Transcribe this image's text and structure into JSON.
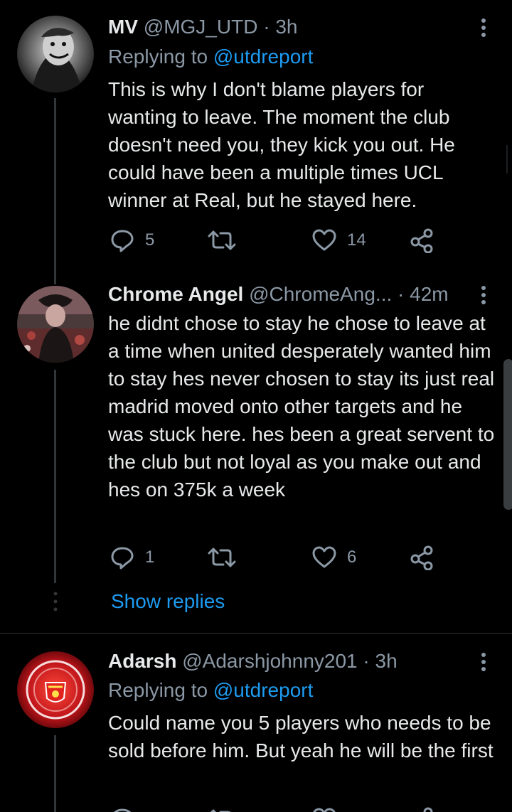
{
  "tweets": [
    {
      "name": "MV",
      "handle": "@MGJ_UTD",
      "sep": "·",
      "time": "3h",
      "replying_prefix": "Replying to",
      "replying_to": "@utdreport",
      "text": "This is why I don't blame players for wanting to leave. The moment the club doesn't need you, they kick you out. He could have been a multiple times UCL winner at Real, but he stayed here.",
      "reply_count": "5",
      "retweet_count": "",
      "like_count": "14"
    },
    {
      "name": "Chrome Angel",
      "handle": "@ChromeAng...",
      "sep": "·",
      "time": "42m",
      "text": "he didnt chose to stay he chose to leave at a time when united desperately wanted him to stay hes never chosen to stay its just real madrid moved onto other targets and he was stuck here. hes been a great servent to the club but not loyal as you make out and hes on 375k a week",
      "reply_count": "1",
      "retweet_count": "",
      "like_count": "6",
      "show_replies": "Show replies"
    },
    {
      "name": "Adarsh",
      "handle": "@Adarshjohnny201",
      "sep": "·",
      "time": "3h",
      "replying_prefix": "Replying to",
      "replying_to": "@utdreport",
      "text": "Could name you 5 players who needs to be sold before him. But yeah he will be the first"
    }
  ],
  "icons": {
    "reply": "reply-icon",
    "retweet": "retweet-icon",
    "like": "heart-icon",
    "share": "share-icon",
    "more": "more-vertical-icon"
  },
  "colors": {
    "background": "#000000",
    "text": "#e7e9ea",
    "secondary": "#8b98a5",
    "accent": "#1d9bf0"
  }
}
